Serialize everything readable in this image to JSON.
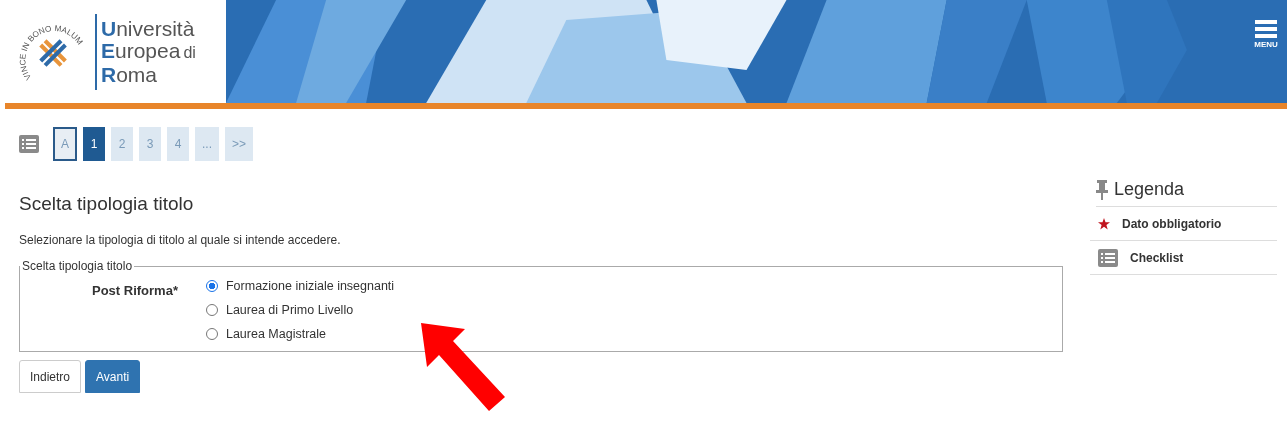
{
  "header": {
    "logo_motto": "VINCE IN BONO MALUM",
    "logo_lines": [
      {
        "initial": "U",
        "rest": "niversità"
      },
      {
        "initial": "E",
        "rest": "uropea",
        "suffix": "di"
      },
      {
        "initial": "R",
        "rest": "oma"
      }
    ],
    "menu_label": "MENU"
  },
  "steps": [
    {
      "label": "A",
      "kind": "outline",
      "selected": false
    },
    {
      "label": "1",
      "kind": "page",
      "selected": true
    },
    {
      "label": "2",
      "kind": "page",
      "selected": false
    },
    {
      "label": "3",
      "kind": "page",
      "selected": false
    },
    {
      "label": "4",
      "kind": "page",
      "selected": false
    },
    {
      "label": "...",
      "kind": "page",
      "selected": false
    },
    {
      "label": ">>",
      "kind": "page",
      "selected": false
    }
  ],
  "title": "Scelta tipologia titolo",
  "instructions": "Selezionare la tipologia di titolo al quale si intende accedere.",
  "fieldset": {
    "legend": "Scelta tipologia titolo",
    "label": "Post Riforma*",
    "options": [
      {
        "label": "Formazione iniziale insegnanti",
        "selected": true
      },
      {
        "label": "Laurea di Primo Livello",
        "selected": false
      },
      {
        "label": "Laurea Magistrale",
        "selected": false
      }
    ]
  },
  "buttons": [
    {
      "label": "Indietro",
      "kind": "secondary"
    },
    {
      "label": "Avanti",
      "kind": "primary"
    }
  ],
  "legend": {
    "title": "Legenda",
    "items": [
      {
        "label": "Dato obbligatorio",
        "kind": "required"
      },
      {
        "label": "Checklist",
        "kind": "checklist"
      }
    ]
  }
}
